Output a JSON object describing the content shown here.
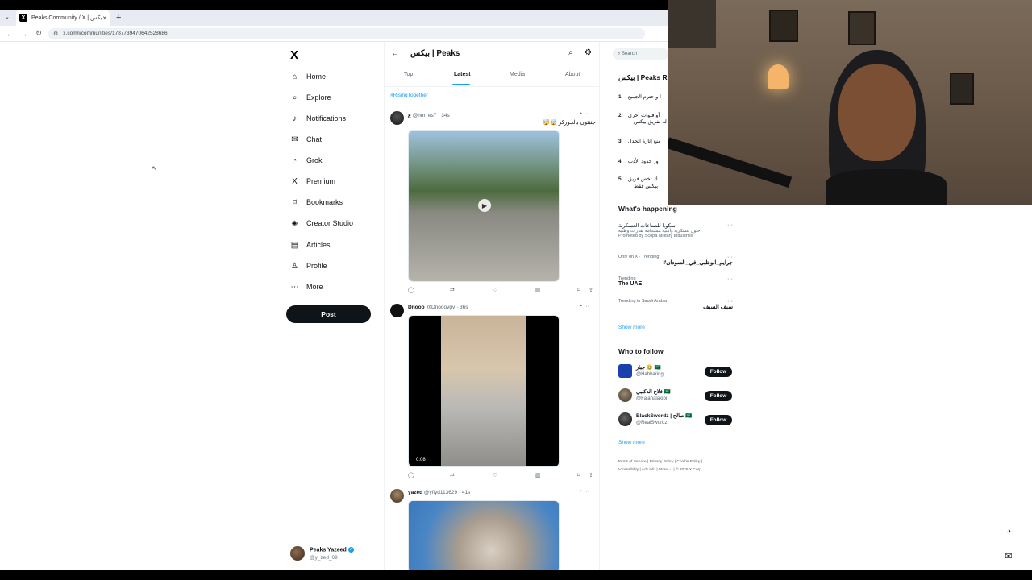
{
  "browser": {
    "tab_title": "Peaks Community / X | بيكس",
    "tab_close": "×",
    "tab_icon": "X",
    "new_tab": "+",
    "url": "x.com/i/communities/1787739470642528686"
  },
  "sidebar": {
    "logo": "X",
    "items": [
      {
        "label": "Home",
        "icon": "⌂"
      },
      {
        "label": "Explore",
        "icon": "⌕"
      },
      {
        "label": "Notifications",
        "icon": "♪"
      },
      {
        "label": "Chat",
        "icon": "✉"
      },
      {
        "label": "Grok",
        "icon": "◔"
      },
      {
        "label": "Premium",
        "icon": "X"
      },
      {
        "label": "Bookmarks",
        "icon": "⌑"
      },
      {
        "label": "Creator Studio",
        "icon": "◈"
      },
      {
        "label": "Articles",
        "icon": "▤"
      },
      {
        "label": "Profile",
        "icon": "♙"
      },
      {
        "label": "More",
        "icon": "⋯"
      }
    ],
    "post_button": "Post",
    "account": {
      "name": "Peaks Yazeed",
      "handle": "@y_zed_09",
      "more": "···"
    }
  },
  "main": {
    "back": "←",
    "title": "بيكس | Peaks",
    "tabs": [
      "Top",
      "Latest",
      "Media",
      "About"
    ],
    "active_tab": "Latest",
    "hashtag": "#RisingTogether",
    "posts": [
      {
        "name": "ع",
        "handle": "@hm_es7 · 34s",
        "text": "جننتون بالجوزكر 🤯🤯",
        "icons": "◔  ···"
      },
      {
        "name": "Dnooo",
        "handle": "@Dnooovgv · 36s",
        "text": "",
        "duration": "0:08",
        "icons": "◔  ···"
      },
      {
        "name": "yazed",
        "handle": "@yfiyd113629 · 41s",
        "text": "",
        "icons": "◔  ···"
      }
    ],
    "actions": {
      "reply": "◯",
      "repost": "⇄",
      "like": "♡",
      "views": "▥",
      "bookmark": "⌑",
      "share": "⇪"
    }
  },
  "right": {
    "search_placeholder": "Search",
    "rules_title": "بيكس | Peaks Ru",
    "rules": [
      {
        "n": "1",
        "text": "ا واحترم الجميع"
      },
      {
        "n": "2",
        "text": "أو قنوات أخرى"
      },
      {
        "n": "2b",
        "text": "له لفريق بيكس"
      },
      {
        "n": "3",
        "text": "منع إثارة الجدل"
      },
      {
        "n": "4",
        "text": "وز حدود الأدب"
      },
      {
        "n": "5",
        "text": "ك تخص فريق"
      },
      {
        "n": "5b",
        "text": "بيكس فقط"
      }
    ],
    "whats_happening": "What's happening",
    "trends": [
      {
        "cat": "سكوبا للصناعات العسكرية",
        "val": "حلول عسكرية وأمنية مستدامة بقدرات وطنية",
        "extra": "Promoted by Scopa Military Industries"
      },
      {
        "cat": "Only on X · Trending",
        "val": "#جرايم_ابوظبي_في_السودان"
      },
      {
        "cat": "Trending",
        "val": "The UAE"
      },
      {
        "cat": "Trending in Saudi Arabia",
        "val": "سيف السيف"
      }
    ],
    "show_more": "Show more",
    "who_to_follow": "Who to follow",
    "follow": [
      {
        "name": "جبار 😊 🇸🇦",
        "handle": "@Habbaring",
        "btn": "Follow"
      },
      {
        "name": "فلاح الدكلبي 🇸🇦",
        "handle": "@Falahalakibi",
        "btn": "Follow"
      },
      {
        "name": "BlackSwordz | صالح 🇸🇦",
        "handle": "@RealSwordz",
        "btn": "Follow"
      }
    ],
    "show_more_2": "Show more",
    "footer_1": "Terms of Service  |  Privacy Policy  |  Cookie Policy  |",
    "footer_2": "Accessibility  |  Ads info  |  More ···  |  © 2026 X Corp."
  }
}
